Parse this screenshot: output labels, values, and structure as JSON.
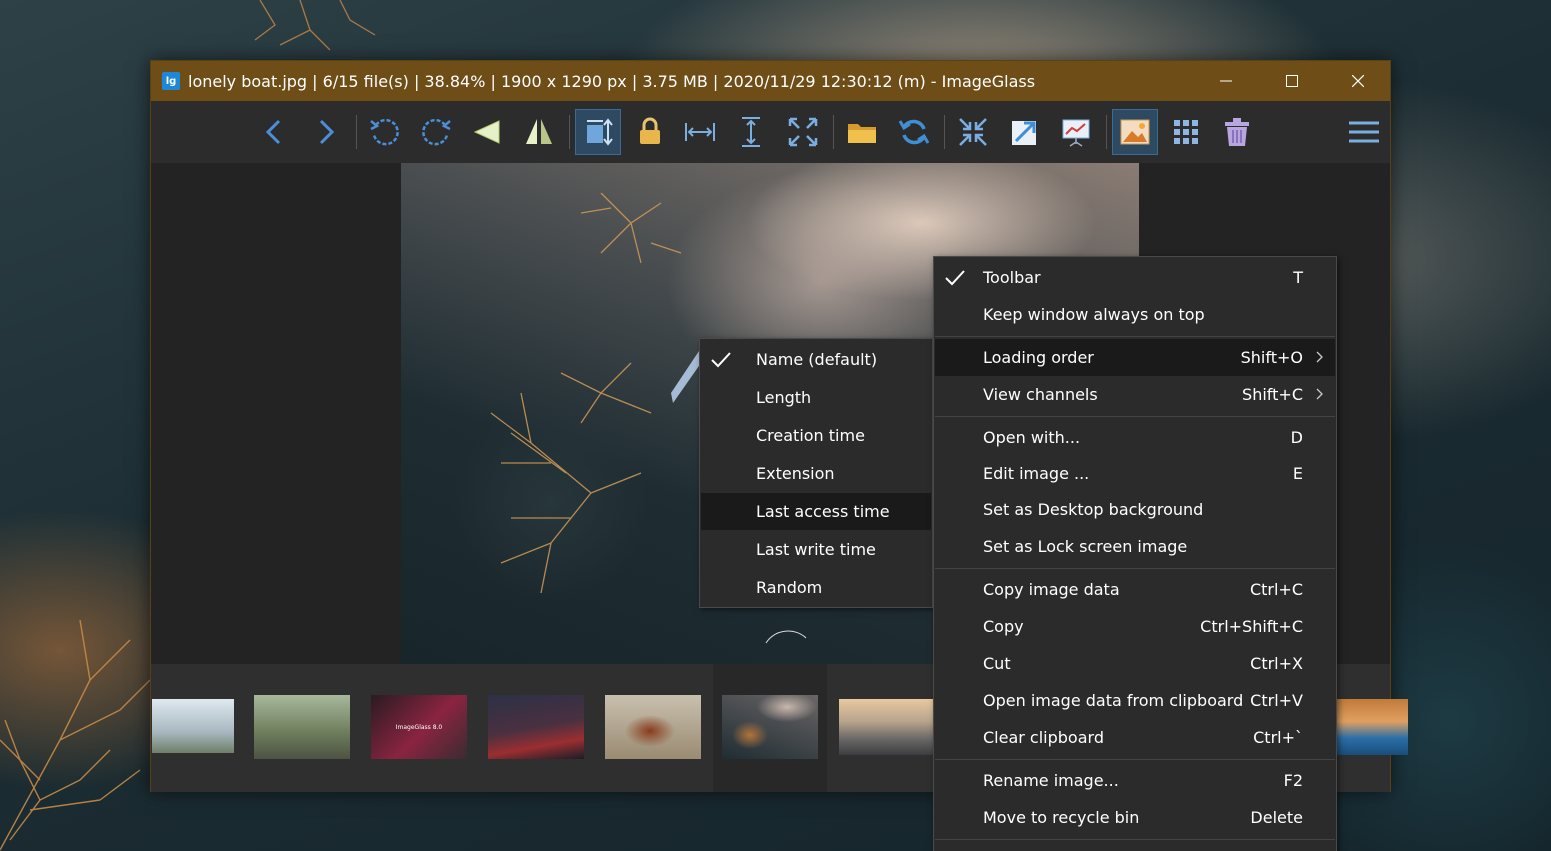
{
  "window": {
    "title": "lonely boat.jpg  |  6/15 file(s)  |  38.84%  |  1900 x 1290 px  |  3.75 MB  |  2020/11/29 12:30:12 (m)  - ImageGlass",
    "app_icon_label": "lg",
    "controls": {
      "minimize": "—",
      "maximize": "☐",
      "close": "✕"
    }
  },
  "toolbar": {
    "buttons": [
      {
        "name": "previous-image",
        "icon": "chevron-left-icon"
      },
      {
        "name": "next-image",
        "icon": "chevron-right-icon"
      },
      {
        "name": "rotate-left",
        "icon": "rotate-left-icon"
      },
      {
        "name": "rotate-right",
        "icon": "rotate-right-icon"
      },
      {
        "name": "flip-horizontal",
        "icon": "flip-horizontal-icon"
      },
      {
        "name": "flip-vertical",
        "icon": "flip-vertical-icon"
      },
      {
        "name": "auto-zoom",
        "icon": "auto-zoom-icon",
        "active": true
      },
      {
        "name": "lock-zoom",
        "icon": "lock-icon"
      },
      {
        "name": "scale-to-width",
        "icon": "scale-width-icon"
      },
      {
        "name": "scale-to-height",
        "icon": "scale-height-icon"
      },
      {
        "name": "scale-to-fit",
        "icon": "scale-fit-icon"
      },
      {
        "name": "open-file",
        "icon": "folder-icon"
      },
      {
        "name": "refresh",
        "icon": "refresh-icon"
      },
      {
        "name": "full-screen",
        "icon": "fullscreen-icon"
      },
      {
        "name": "go-to-image",
        "icon": "external-arrow-icon"
      },
      {
        "name": "slideshow",
        "icon": "slideshow-icon"
      },
      {
        "name": "thumbnail-bar",
        "icon": "image-icon",
        "active": true
      },
      {
        "name": "checkerboard",
        "icon": "grid-icon"
      },
      {
        "name": "delete",
        "icon": "trash-icon"
      },
      {
        "name": "main-menu",
        "icon": "hamburger-menu-icon"
      }
    ]
  },
  "context_menu": {
    "items": [
      {
        "label": "Toolbar",
        "shortcut": "T",
        "checked": true
      },
      {
        "label": "Keep window always on top",
        "shortcut": ""
      },
      {
        "label": "Loading order",
        "shortcut": "Shift+O",
        "submenu": true,
        "highlighted": true
      },
      {
        "label": "View channels",
        "shortcut": "Shift+C",
        "submenu": true
      },
      {
        "label": "Open with...",
        "shortcut": "D"
      },
      {
        "label": "Edit image ...",
        "shortcut": "E"
      },
      {
        "label": "Set as Desktop background",
        "shortcut": ""
      },
      {
        "label": "Set as Lock screen image",
        "shortcut": ""
      },
      {
        "label": "Copy image data",
        "shortcut": "Ctrl+C"
      },
      {
        "label": "Copy",
        "shortcut": "Ctrl+Shift+C"
      },
      {
        "label": "Cut",
        "shortcut": "Ctrl+X"
      },
      {
        "label": "Open image data from clipboard",
        "shortcut": "Ctrl+V"
      },
      {
        "label": "Clear clipboard",
        "shortcut": "Ctrl+`"
      },
      {
        "label": "Rename image...",
        "shortcut": "F2"
      },
      {
        "label": "Move to recycle bin",
        "shortcut": "Delete"
      }
    ]
  },
  "loading_order_submenu": {
    "items": [
      {
        "label": "Name (default)",
        "checked": true
      },
      {
        "label": "Length"
      },
      {
        "label": "Creation time"
      },
      {
        "label": "Extension"
      },
      {
        "label": "Last access time",
        "highlighted": true
      },
      {
        "label": "Last write time"
      },
      {
        "label": "Random"
      }
    ]
  },
  "filmstrip": {
    "thumbnails": [
      {
        "name": "foggy-hills"
      },
      {
        "name": "person-on-road"
      },
      {
        "name": "imageglass-splash",
        "text": "ImageGlass 8.0"
      },
      {
        "name": "red-mountains"
      },
      {
        "name": "cow-in-field"
      },
      {
        "name": "lonely-boat",
        "selected": true
      },
      {
        "name": "bridge-sunset"
      },
      {
        "name": "coast"
      }
    ]
  },
  "colors": {
    "titlebar": "#6e4d17",
    "toolbar": "#2c2c2c",
    "menu_bg": "#2b2b2b",
    "menu_highlight": "#1a1a1a",
    "icon_blue": "#4a8fd8",
    "icon_gold": "#e8b64a"
  }
}
